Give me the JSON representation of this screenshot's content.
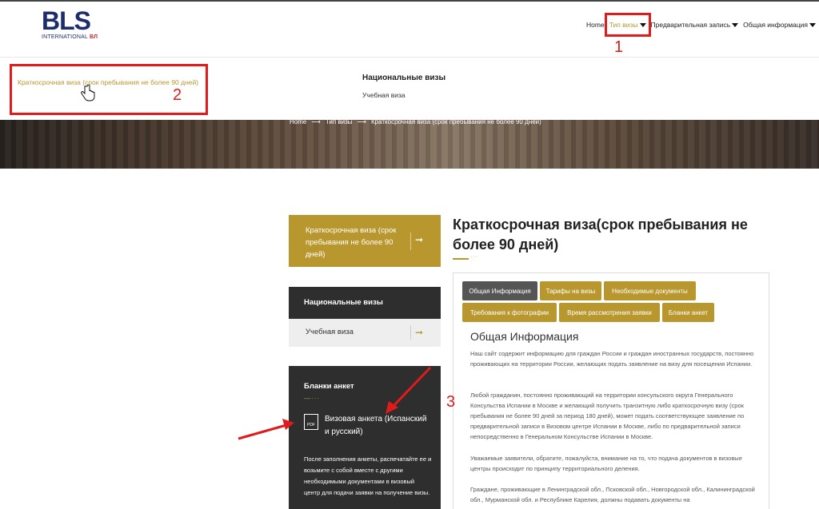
{
  "logo": {
    "main": "BLS",
    "sub": "INTERNATIONAL",
    "sub_mark": "ВЛ"
  },
  "nav": {
    "items": [
      {
        "label": "Home"
      },
      {
        "label": "Тип визы"
      },
      {
        "label": "Предварительная запись"
      },
      {
        "label": "Общая информация"
      }
    ]
  },
  "dropdown": {
    "left_link": "Краткосрочная виза (срок пребывания не более 90 дней)",
    "national_title": "Национальные визы",
    "national_item": "Учебная виза"
  },
  "breadcrumb": {
    "home": "Home",
    "sep": "⟶",
    "level1": "Тип визы",
    "level2": "Краткосрочная виза (срок пребывания не более 90 дней)"
  },
  "sidebar": {
    "current": "Краткосрочная виза (срок пребывания не более 90 дней)",
    "arrow": "➞",
    "national_title": "Национальные визы",
    "study_visa": "Учебная виза",
    "forms_title": "Бланки анкет",
    "forms_dots": "—···",
    "pdf_label": "PDF",
    "pdf_link": "Визовая анкета (Испанский и русский)",
    "forms_desc": "После заполнения анкеты, распечатайте ее и возьмите с собой вместе с другими необходимыми документами в визовый центр для подачи заявки на получение визы."
  },
  "main": {
    "title": "Краткосрочная виза(срок пребывания не более 90 дней)",
    "dots": "···",
    "tabs": [
      {
        "label": "Общая Информация"
      },
      {
        "label": "Тарифы на визы"
      },
      {
        "label": "Необходимые документы"
      },
      {
        "label": "Требования к фотографии"
      },
      {
        "label": "Время рассмотрения заявки"
      },
      {
        "label": "Бланки анкет"
      }
    ],
    "content_title": "Общая Информация",
    "paragraphs": [
      "Наш сайт содержит информацию для граждан России и граждан иностранных государств, постоянно проживающих на территории России, желающих подать заявление на визу для посещения Испании.",
      "Любой гражданин, постоянно проживающий на территории консульского округа Генерального Консульства Испании в Москве и желающий получить транзитную либо краткосрочную визу (срок пребывания не более 90 дней за период 180 дней), может подать соответствующее заявление по предварительной записи в Визовом центре Испании в Москве, либо по предварительной записи непосредственно в Генеральном Консульстве Испании в Москве.",
      "Уважаемые заявители, обратите, пожалуйста, внимание на то, что подача документов в визовые центры происходит по принципу территориального деления.",
      "Граждане, проживающие в Ленинградской обл., Псковской обл., Новгородской обл., Калининградской обл., Мурманской обл. и Республике Карелия, должны подавать документы на"
    ]
  },
  "annotations": {
    "n1": "1",
    "n2": "2",
    "n3": "3"
  },
  "colors": {
    "gold": "#b9972f",
    "dark": "#2e2e2e",
    "red": "#e01b1b",
    "navy": "#1d2d6b"
  }
}
